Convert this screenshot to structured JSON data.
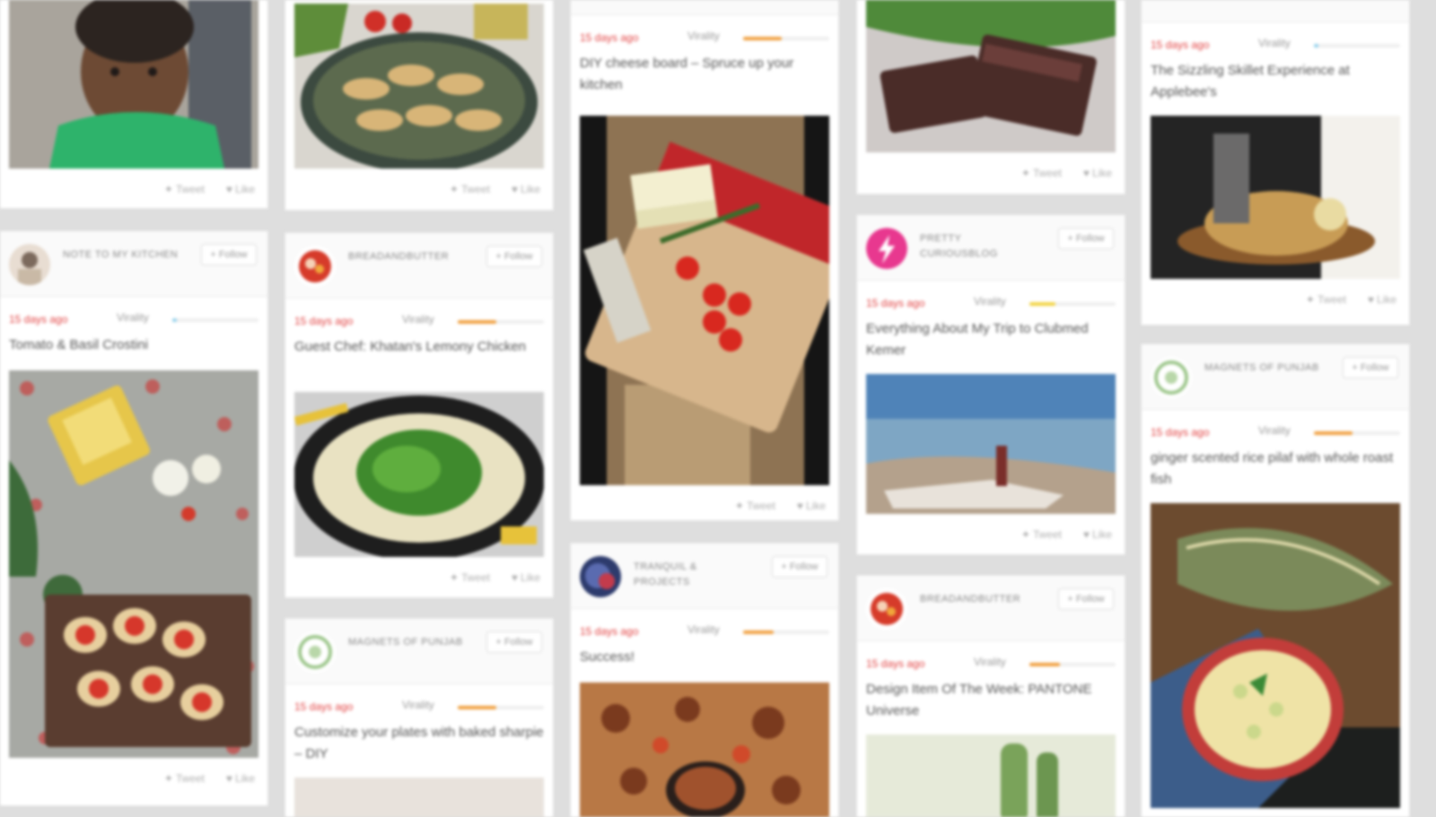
{
  "common": {
    "follow": "+ Follow",
    "virality": "Virality",
    "tweet": "Tweet",
    "like": "Like"
  },
  "colors": {
    "time": "#e24444",
    "orange": "#f0a040",
    "yellow": "#f2d340",
    "blue": "#8fd0ec"
  },
  "cards": [
    {
      "id": "c1",
      "author": "",
      "time": "",
      "title": "",
      "virality": 0
    },
    {
      "id": "c2",
      "author": "NOTE TO MY KITCHEN",
      "time": "15 days ago",
      "title": "Tomato & Basil Crostini",
      "virality": 0.05
    },
    {
      "id": "c3",
      "author": "",
      "time": "",
      "title": "",
      "virality": 0
    },
    {
      "id": "c4",
      "author": "BREADANDBUTTER",
      "time": "15 days ago",
      "title": "Guest Chef: Khatan's Lemony Chicken",
      "virality": 0.45
    },
    {
      "id": "c5",
      "author": "MAGNETS OF PUNJAB",
      "time": "15 days ago",
      "title": "Customize your plates with baked sharpie – DIY",
      "virality": 0.45
    },
    {
      "id": "c6",
      "author": "",
      "time": "15 days ago",
      "title": "DIY cheese board – Spruce up your kitchen",
      "virality": 0.45
    },
    {
      "id": "c7",
      "author": "TRANQUIL & PROJECTS",
      "time": "15 days ago",
      "title": "Success!",
      "virality": 0.35
    },
    {
      "id": "c8",
      "author": "",
      "time": "",
      "title": "",
      "virality": 0
    },
    {
      "id": "c9",
      "author": "PRETTY CURIOUSBLOG",
      "time": "15 days ago",
      "title": "Everything About My Trip to Clubmed Kemer",
      "virality": 0.3
    },
    {
      "id": "c10",
      "author": "BREADANDBUTTER",
      "time": "15 days ago",
      "title": "Design Item Of The Week: PANTONE Universe",
      "virality": 0.35
    },
    {
      "id": "c11",
      "author": "",
      "time": "15 days ago",
      "title": "The Sizzling Skillet Experience at Applebee's",
      "virality": 0.05
    },
    {
      "id": "c12",
      "author": "MAGNETS OF PUNJAB",
      "time": "15 days ago",
      "title": "ginger scented rice pilaf with whole roast fish",
      "virality": 0.45
    }
  ]
}
